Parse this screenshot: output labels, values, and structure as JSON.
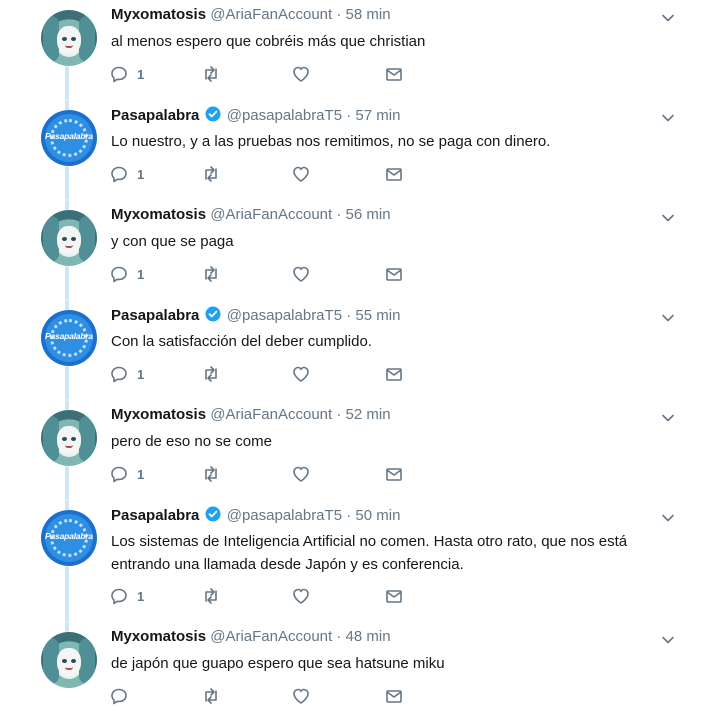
{
  "colors": {
    "thread_line": "#cfe6f7",
    "verified_badge": "#1da1f2",
    "secondary_text": "#657786",
    "primary_text": "#14171a"
  },
  "tweets": [
    {
      "author": "Myxomatosis",
      "handle": "@AriaFanAccount",
      "separator": "·",
      "time": "58 min",
      "verified": false,
      "avatar": "anime-avatar",
      "text": "al menos espero que cobréis más que christian",
      "reply_count": "1"
    },
    {
      "author": "Pasapalabra",
      "handle": "@pasapalabraT5",
      "separator": "·",
      "time": "57 min",
      "verified": true,
      "avatar": "pasapalabra-logo",
      "avatar_text": "Pasapalabra",
      "text": "Lo nuestro, y a las pruebas nos remitimos, no se paga con dinero.",
      "reply_count": "1"
    },
    {
      "author": "Myxomatosis",
      "handle": "@AriaFanAccount",
      "separator": "·",
      "time": "56 min",
      "verified": false,
      "avatar": "anime-avatar",
      "text": "y con que se paga",
      "reply_count": "1"
    },
    {
      "author": "Pasapalabra",
      "handle": "@pasapalabraT5",
      "separator": "·",
      "time": "55 min",
      "verified": true,
      "avatar": "pasapalabra-logo",
      "avatar_text": "Pasapalabra",
      "text": "Con la satisfacción del deber cumplido.",
      "reply_count": "1"
    },
    {
      "author": "Myxomatosis",
      "handle": "@AriaFanAccount",
      "separator": "·",
      "time": "52 min",
      "verified": false,
      "avatar": "anime-avatar",
      "text": "pero de eso no se come",
      "reply_count": "1"
    },
    {
      "author": "Pasapalabra",
      "handle": "@pasapalabraT5",
      "separator": "·",
      "time": "50 min",
      "verified": true,
      "avatar": "pasapalabra-logo",
      "avatar_text": "Pasapalabra",
      "text": "Los sistemas de Inteligencia Artificial no comen. Hasta otro rato, que nos está entrando una llamada desde Japón y es conferencia.",
      "reply_count": "1"
    },
    {
      "author": "Myxomatosis",
      "handle": "@AriaFanAccount",
      "separator": "·",
      "time": "48 min",
      "verified": false,
      "avatar": "anime-avatar",
      "text": "de japón que guapo espero que sea hatsune miku",
      "reply_count": ""
    }
  ]
}
